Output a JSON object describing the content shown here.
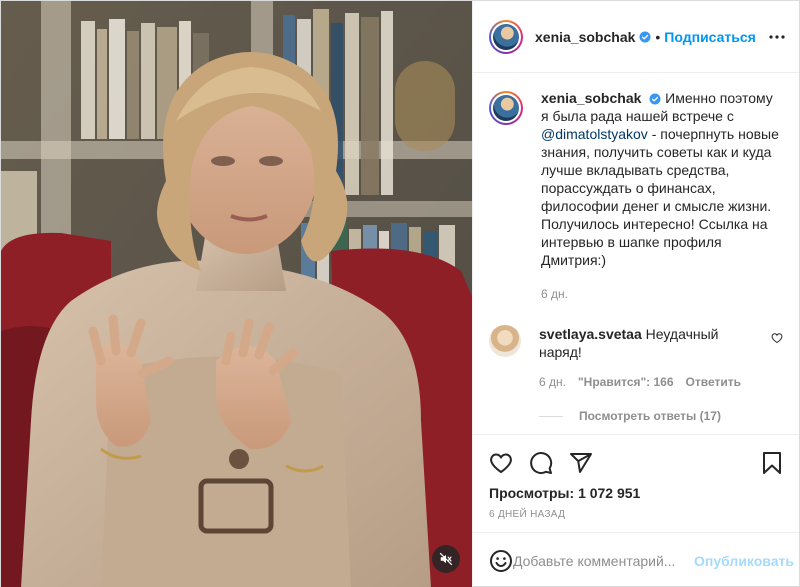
{
  "post": {
    "author": {
      "username": "xenia_sobchak",
      "verified": true,
      "follow_label": "Подписаться",
      "separator": "•"
    },
    "caption": {
      "username": "xenia_sobchak",
      "text_before_mention": "Именно поэтому я была рада нашей встрече с",
      "mention": "@dimatolstyakov",
      "text_after_mention": "- почерпнуть новые знания, получить советы как и куда лучше вкладывать средства, порассуждать о финансах, философии денег и смысле жизни. Получилось интересно! Ссылка на интервью в шапке профиля Дмитрия:)",
      "time": "6 дн."
    },
    "comments": [
      {
        "username": "svetlaya.svetaa",
        "text": "Неудачный наряд!",
        "time": "6 дн.",
        "likes_label": "\"Нравится\": 166",
        "reply_label": "Ответить",
        "view_replies_label": "Посмотреть ответы (17)"
      }
    ],
    "stats": {
      "views_label": "Просмотры:",
      "views_value": "1 072 951",
      "date": "6 ДНЕЙ НАЗАД"
    },
    "add_comment": {
      "placeholder": "Добавьте комментарий...",
      "post_label": "Опубликовать"
    },
    "icons": {
      "header_more": "more-horizontal-icon",
      "like": "heart-icon",
      "comment": "comment-icon",
      "share": "share-icon",
      "save": "bookmark-icon",
      "emoji": "emoji-icon",
      "mute": "volume-muted-icon",
      "comment_like": "heart-small-icon"
    },
    "colors": {
      "accent": "#0095f6",
      "mention": "#00376b",
      "muted_text": "#8e8e8e",
      "text": "#262626",
      "border": "#dbdbdb"
    }
  }
}
